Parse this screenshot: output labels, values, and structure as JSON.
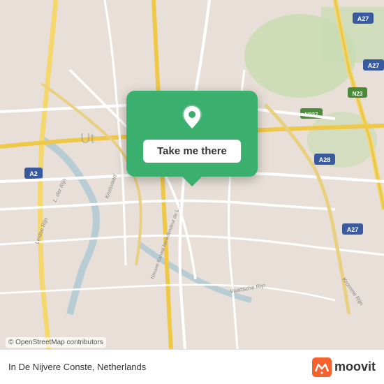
{
  "map": {
    "background_color": "#e8e0d8",
    "attribution": "© OpenStreetMap contributors"
  },
  "popup": {
    "button_label": "Take me there",
    "pin_color": "#ffffff",
    "card_color": "#3aaf6e"
  },
  "footer": {
    "location_name": "In De Nijvere Conste, Netherlands",
    "logo_text": "moovit"
  }
}
